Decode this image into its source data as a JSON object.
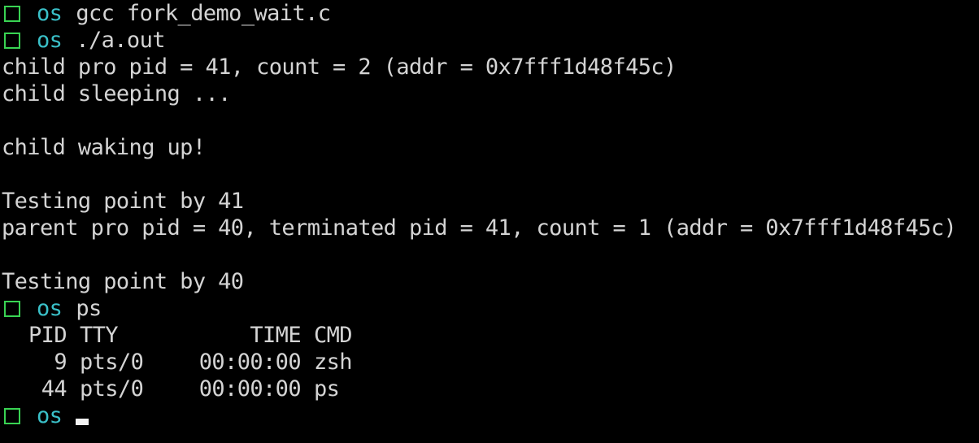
{
  "colors": {
    "background": "#000000",
    "text": "#d4d4d4",
    "prompt_box": "#39d353",
    "prompt_dir": "#3ac0c8",
    "cursor": "#f2f2f2"
  },
  "prompt": {
    "dir": "os",
    "icon": "prompt-square-icon"
  },
  "lines": {
    "cmd1": "gcc fork_demo_wait.c",
    "cmd2": "./a.out",
    "out1": "child pro pid = 41, count = 2 (addr = 0x7fff1d48f45c)",
    "out2": "child sleeping ...",
    "out3": "child waking up!",
    "out4": "Testing point by 41",
    "out5": "parent pro pid = 40, terminated pid = 41, count = 1 (addr = 0x7fff1d48f45c)",
    "out6": "Testing point by 40",
    "cmd3": "ps"
  },
  "ps": {
    "headers": {
      "pid": "PID",
      "tty": "TTY",
      "time": "TIME",
      "cmd": "CMD"
    },
    "rows": [
      {
        "pid": "9",
        "tty": "pts/0",
        "time": "00:00:00",
        "cmd": "zsh"
      },
      {
        "pid": "44",
        "tty": "pts/0",
        "time": "00:00:00",
        "cmd": "ps"
      }
    ]
  }
}
